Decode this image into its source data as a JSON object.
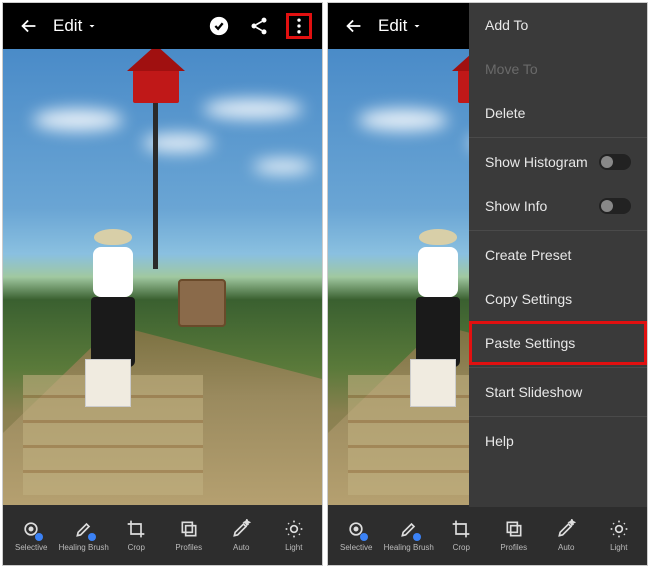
{
  "left": {
    "topbar": {
      "edit_label": "Edit"
    },
    "tools": [
      {
        "label": "Selective"
      },
      {
        "label": "Healing Brush"
      },
      {
        "label": "Crop"
      },
      {
        "label": "Profiles"
      },
      {
        "label": "Auto"
      },
      {
        "label": "Light"
      }
    ]
  },
  "right": {
    "topbar": {
      "edit_label": "Edit"
    },
    "menu": {
      "add_to": "Add To",
      "move_to": "Move To",
      "delete": "Delete",
      "show_histogram": "Show Histogram",
      "show_info": "Show Info",
      "create_preset": "Create Preset",
      "copy_settings": "Copy Settings",
      "paste_settings": "Paste Settings",
      "start_slideshow": "Start Slideshow",
      "help": "Help"
    },
    "tools": [
      {
        "label": "Selective"
      },
      {
        "label": "Healing Brush"
      },
      {
        "label": "Crop"
      },
      {
        "label": "Profiles"
      },
      {
        "label": "Auto"
      },
      {
        "label": "Light"
      }
    ]
  }
}
